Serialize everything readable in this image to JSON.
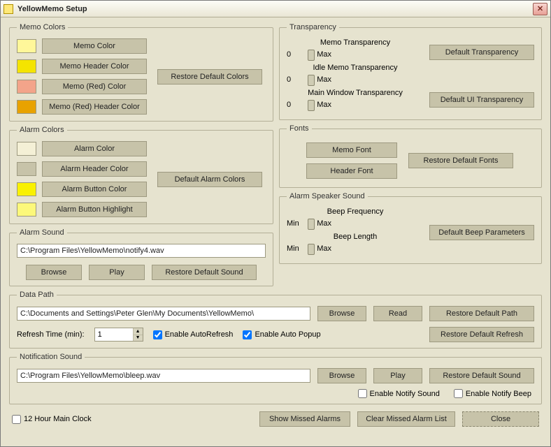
{
  "window": {
    "title": "YellowMemo Setup"
  },
  "memoColors": {
    "legend": "Memo Colors",
    "items": [
      {
        "swatch": "#fff79a",
        "label": "Memo Color"
      },
      {
        "swatch": "#f4e400",
        "label": "Memo Header Color"
      },
      {
        "swatch": "#f3a48a",
        "label": "Memo (Red) Color"
      },
      {
        "swatch": "#e8a200",
        "label": "Memo (Red) Header Color"
      }
    ],
    "restore": "Restore Default Colors"
  },
  "alarmColors": {
    "legend": "Alarm Colors",
    "items": [
      {
        "swatch": "#f4f0d6",
        "label": "Alarm Color"
      },
      {
        "swatch": "#c7c3a9",
        "label": "Alarm Header Color"
      },
      {
        "swatch": "#f9f100",
        "label": "Alarm Button Color"
      },
      {
        "swatch": "#fcf87a",
        "label": "Alarm Button Highlight"
      }
    ],
    "restore": "Default Alarm Colors"
  },
  "alarmSound": {
    "legend": "Alarm Sound",
    "path": "C:\\Program Files\\YellowMemo\\notify4.wav",
    "browse": "Browse",
    "play": "Play",
    "restore": "Restore Default Sound"
  },
  "transparency": {
    "legend": "Transparency",
    "sliders": [
      {
        "title": "Memo Transparency",
        "min": "0",
        "max": "Max",
        "pos": 0.92
      },
      {
        "title": "Idle Memo Transparency",
        "min": "0",
        "max": "Max",
        "pos": 0.92
      },
      {
        "title": "Main Window Transparency",
        "min": "0",
        "max": "Max",
        "pos": 0.92
      }
    ],
    "btn1": "Default Transparency",
    "btn2": "Default UI Transparency"
  },
  "fonts": {
    "legend": "Fonts",
    "memoFont": "Memo Font",
    "headerFont": "Header Font",
    "restore": "Restore Default Fonts"
  },
  "speaker": {
    "legend": "Alarm Speaker Sound",
    "sliders": [
      {
        "title": "Beep Frequency",
        "min": "Min",
        "max": "Max",
        "pos": 0.5
      },
      {
        "title": "Beep Length",
        "min": "Min",
        "max": "Max",
        "pos": 0.5
      }
    ],
    "restore": "Default Beep Parameters"
  },
  "dataPath": {
    "legend": "Data Path",
    "path": "C:\\Documents and Settings\\Peter Glen\\My Documents\\YellowMemo\\",
    "browse": "Browse",
    "read": "Read",
    "restorePath": "Restore Default Path",
    "refreshLabel": "Refresh Time (min):",
    "refreshValue": "1",
    "autoRefresh": "Enable AutoRefresh",
    "autoRefreshChecked": true,
    "autoPopup": "Enable Auto Popup",
    "autoPopupChecked": true,
    "restoreRefresh": "Restore Default Refresh"
  },
  "notify": {
    "legend": "Notification Sound",
    "path": "C:\\Program Files\\YellowMemo\\bleep.wav",
    "browse": "Browse",
    "play": "Play",
    "restore": "Restore Default Sound",
    "enableSound": "Enable Notify Sound",
    "enableSoundChecked": false,
    "enableBeep": "Enable Notify Beep",
    "enableBeepChecked": false
  },
  "footer": {
    "clock12": "12 Hour Main Clock",
    "clock12Checked": false,
    "showMissed": "Show Missed Alarms",
    "clearMissed": "Clear Missed Alarm List",
    "close": "Close"
  }
}
